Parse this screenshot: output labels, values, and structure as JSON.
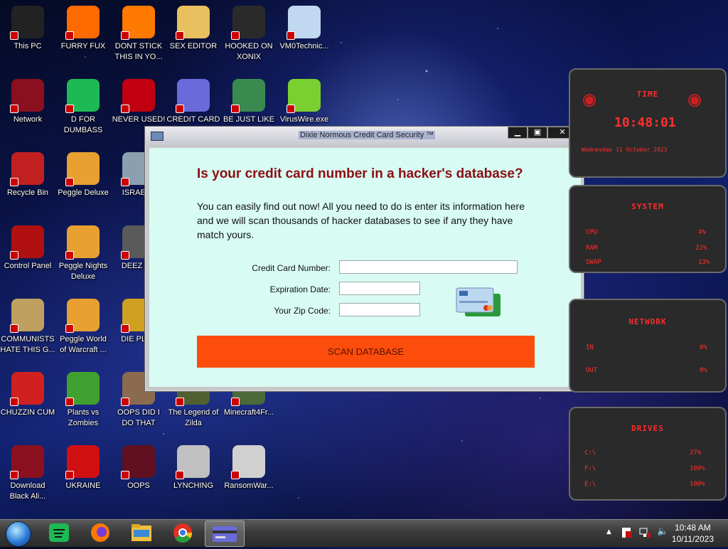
{
  "desktop": {
    "icons": [
      {
        "label": "This PC",
        "color": "#222222"
      },
      {
        "label": "FURRY FUX",
        "color": "#ff6a00"
      },
      {
        "label": "DONT STICK THIS IN YO...",
        "color": "#ff7a00"
      },
      {
        "label": "SEX EDITOR",
        "color": "#e8c060"
      },
      {
        "label": "HOOKED ON XONIX",
        "color": "#2a2a2a"
      },
      {
        "label": "VM0Technic...",
        "color": "#c0d8f0"
      },
      {
        "label": "Network",
        "color": "#8a1020"
      },
      {
        "label": "D FOR DUMBASS",
        "color": "#1db954"
      },
      {
        "label": "NEVER USED!",
        "color": "#c00010"
      },
      {
        "label": "CREDIT CARD CHECKER",
        "color": "#6a6adb"
      },
      {
        "label": "BE JUST LIKE THE DUDE!",
        "color": "#3a8a50"
      },
      {
        "label": "VirusWire.exe",
        "color": "#7ad030"
      },
      {
        "label": "Recycle Bin",
        "color": "#c02020"
      },
      {
        "label": "Peggle Deluxe",
        "color": "#e8a030"
      },
      {
        "label": "ISRAELS",
        "color": "#8aa0b0"
      },
      {
        "label": "Control Panel",
        "color": "#b01010"
      },
      {
        "label": "Peggle Nights Deluxe",
        "color": "#e8a030"
      },
      {
        "label": "DEEZ NU",
        "color": "#5a5a5a"
      },
      {
        "label": "COMMUNISTS HATE THIS G...",
        "color": "#c0a060"
      },
      {
        "label": "Peggle World of Warcraft ...",
        "color": "#e8a030"
      },
      {
        "label": "DIE PLEA",
        "color": "#d0a020"
      },
      {
        "label": "CHUZZIN CUM",
        "color": "#d02020"
      },
      {
        "label": "Plants vs Zombies",
        "color": "#40a030"
      },
      {
        "label": "OOPS DID I DO THAT",
        "color": "#8a6a50"
      },
      {
        "label": "The Legend of Zilda",
        "color": "#506030"
      },
      {
        "label": "Minecraft4Fr...",
        "color": "#4a6a3a"
      },
      {
        "label": "Download Black Ali...",
        "color": "#8a1020"
      },
      {
        "label": "UKRAINE",
        "color": "#d01010"
      },
      {
        "label": "OOPS",
        "color": "#601020"
      },
      {
        "label": "LYNCHING",
        "color": "#c0c0c0"
      },
      {
        "label": "RansomWar...",
        "color": "#d0d0d0"
      }
    ]
  },
  "dialog": {
    "title": "Dixie Normous Credit Card Security ™",
    "minimize": "▁",
    "maximize": "▣",
    "close": "✕",
    "heading": "Is your credit card number in a hacker's database?",
    "description": "You can easily find out now! All you need to do is enter its information here and we will scan thousands of hacker databases to see if any they have match yours.",
    "fields": {
      "card_number_label": "Credit Card Number:",
      "card_number_value": "",
      "expiration_label": "Expiration Date:",
      "expiration_value": "",
      "zip_label": "Your Zip Code:",
      "zip_value": ""
    },
    "scan_button": "SCAN DATABASE",
    "accent": "#fd4d0c",
    "heading_color": "#8b0f14"
  },
  "widget": {
    "time_title": "TIME",
    "time": "10:48:01",
    "date": "Wednesday 11 October 2023",
    "system_title": "SYSTEM",
    "cpu_label": "CPU",
    "cpu_value": "4%",
    "ram_label": "RAM",
    "ram_value": "22%",
    "swap_label": "SWAP",
    "swap_value": "13%",
    "network_title": "NETWORK",
    "in_label": "IN",
    "in_value": "0%",
    "out_label": "OUT",
    "out_value": "0%",
    "drives_title": "DRIVES",
    "drives": [
      {
        "name": "C:\\",
        "value": "27%"
      },
      {
        "name": "F:\\",
        "value": "100%"
      },
      {
        "name": "E:\\",
        "value": "100%"
      }
    ],
    "accent": "#ff2a2a"
  },
  "taskbar": {
    "clock_time": "10:48 AM",
    "clock_date": "10/11/2023",
    "tray_arrow": "▲",
    "tray_volume": "🔈"
  }
}
